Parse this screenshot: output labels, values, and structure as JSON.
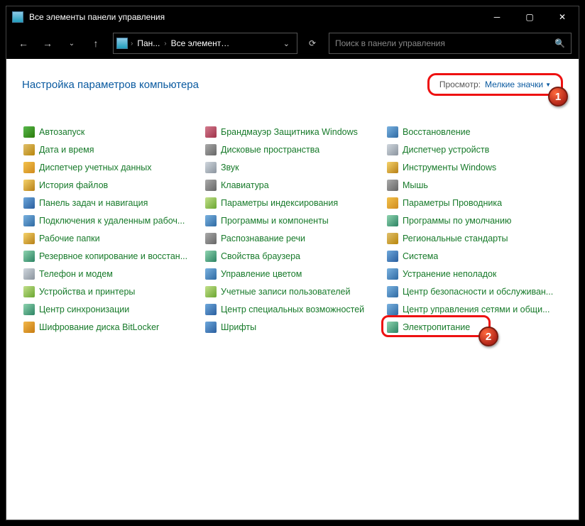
{
  "titlebar": {
    "title": "Все элементы панели управления"
  },
  "nav": {
    "crumb1": "Пан...",
    "crumb2": "Все элементы ...",
    "search_placeholder": "Поиск в панели управления"
  },
  "header": {
    "title": "Настройка параметров компьютера",
    "view_label": "Просмотр:",
    "view_value": "Мелкие значки"
  },
  "callouts": {
    "one": "1",
    "two": "2"
  },
  "cols": [
    [
      "Автозапуск",
      "Дата и время",
      "Диспетчер учетных данных",
      "История файлов",
      "Панель задач и навигация",
      "Подключения к удаленным рабоч...",
      "Рабочие папки",
      "Резервное копирование и восстан...",
      "Телефон и модем",
      "Устройства и принтеры",
      "Центр синхронизации",
      "Шифрование диска BitLocker"
    ],
    [
      "Брандмауэр Защитника Windows",
      "Дисковые пространства",
      "Звук",
      "Клавиатура",
      "Параметры индексирования",
      "Программы и компоненты",
      "Распознавание речи",
      "Свойства браузера",
      "Управление цветом",
      "Учетные записи пользователей",
      "Центр специальных возможностей",
      "Шрифты"
    ],
    [
      "Восстановление",
      "Диспетчер устройств",
      "Инструменты Windows",
      "Мышь",
      "Параметры Проводника",
      "Программы по умолчанию",
      "Региональные стандарты",
      "Система",
      "Устранение неполадок",
      "Центр безопасности и обслуживан...",
      "Центр управления сетями и общи...",
      "Электропитание"
    ]
  ],
  "icon_classes": [
    [
      "ic0",
      "ic1",
      "ic4",
      "ic7",
      "ic2",
      "ic8",
      "ic7",
      "ic9",
      "ic6",
      "ic5",
      "ic9",
      "ic11"
    ],
    [
      "ic10",
      "ic3",
      "ic6",
      "ic3",
      "ic5",
      "ic8",
      "ic3",
      "ic9",
      "ic8",
      "ic5",
      "ic2",
      "ic2"
    ],
    [
      "ic8",
      "ic6",
      "ic7",
      "ic3",
      "ic4",
      "ic9",
      "ic1",
      "ic2",
      "ic8",
      "ic8",
      "ic8",
      "ic9"
    ]
  ]
}
